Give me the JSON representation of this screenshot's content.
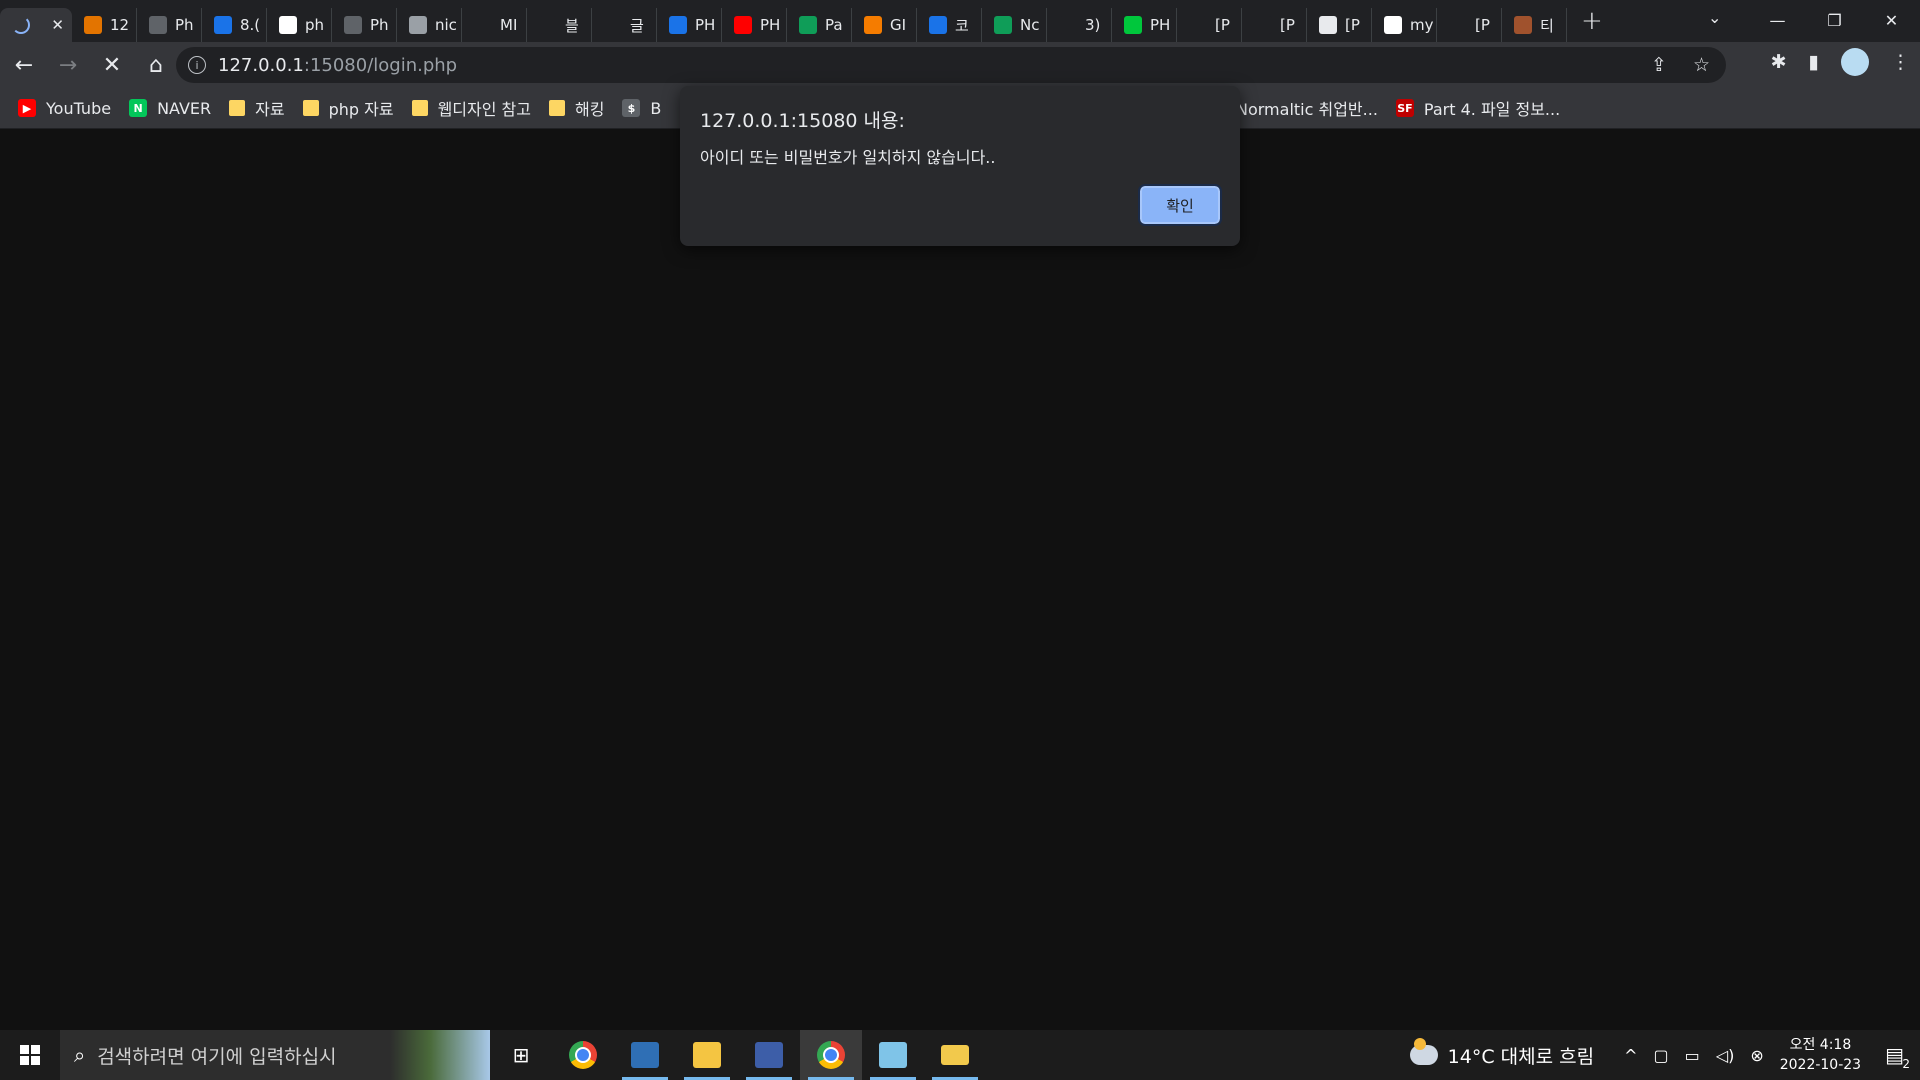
{
  "browser": {
    "tabs": [
      {
        "title": "",
        "active": true,
        "color": "#8ab4f8"
      },
      {
        "title": "12",
        "color": "#e37400"
      },
      {
        "title": "Ph",
        "color": "#5f6368"
      },
      {
        "title": "8.(",
        "color": "#1a73e8"
      },
      {
        "title": "ph",
        "color": "#ffffff"
      },
      {
        "title": "Ph",
        "color": "#5f6368"
      },
      {
        "title": "nic",
        "color": "#9aa0a6"
      },
      {
        "title": "MI",
        "color": "#202124"
      },
      {
        "title": "블",
        "color": "#202124"
      },
      {
        "title": "글",
        "color": "#202124"
      },
      {
        "title": "PH",
        "color": "#1a73e8"
      },
      {
        "title": "PH",
        "color": "#ff0000"
      },
      {
        "title": "Pa",
        "color": "#0f9d58"
      },
      {
        "title": "GI",
        "color": "#f57c00"
      },
      {
        "title": "코",
        "color": "#1a73e8"
      },
      {
        "title": "Nc",
        "color": "#0f9d58"
      },
      {
        "title": "3)",
        "color": "#202124"
      },
      {
        "title": "PH",
        "color": "#00c73c"
      },
      {
        "title": "[P",
        "color": "#202124"
      },
      {
        "title": "[P",
        "color": "#202124"
      },
      {
        "title": "[P",
        "color": "#e8eaed"
      },
      {
        "title": "my",
        "color": "#ffffff"
      },
      {
        "title": "[P",
        "color": "#202124"
      },
      {
        "title": "티",
        "color": "#a0522d"
      }
    ],
    "new_tab": "+",
    "tab_search": "⌄",
    "window_controls": {
      "minimize": "—",
      "restore": "❐",
      "close": "✕"
    }
  },
  "toolbar": {
    "back": "←",
    "forward": "→",
    "stop": "✕",
    "home": "⌂",
    "url_host": "127.0.0.1",
    "url_rest": ":15080/login.php",
    "info_icon": "i",
    "share_icon": "⇪",
    "star_icon": "☆",
    "extensions_icon": "✱",
    "sidepanel_icon": "▮",
    "menu_icon": "⋮"
  },
  "bookmarks": [
    {
      "label": "YouTube",
      "type": "site",
      "color": "#ff0000",
      "glyph": "▶"
    },
    {
      "label": "NAVER",
      "type": "site",
      "color": "#03c75a",
      "glyph": "N"
    },
    {
      "label": "자료",
      "type": "folder"
    },
    {
      "label": "php 자료",
      "type": "folder"
    },
    {
      "label": "웹디자인 참고",
      "type": "folder"
    },
    {
      "label": "해킹",
      "type": "folder"
    },
    {
      "label": "B",
      "type": "site",
      "color": "#5f6368",
      "glyph": "$"
    }
  ],
  "bookmarks_right": [
    {
      "label": "Normaltic 취업반...",
      "type": "text"
    },
    {
      "label": "Part 4. 파일 정보...",
      "type": "site",
      "color": "#c00000",
      "glyph": "SF"
    }
  ],
  "dialog": {
    "title": "127.0.0.1:15080 내용:",
    "message": "아이디 또는 비밀번호가 일치하지 않습니다..",
    "ok_label": "확인"
  },
  "taskbar": {
    "search_placeholder": "검색하려면 여기에 입력하십시",
    "weather": "14°C  대체로 흐림",
    "time": "오전 4:18",
    "date": "2022-10-23",
    "notifications": "2"
  }
}
